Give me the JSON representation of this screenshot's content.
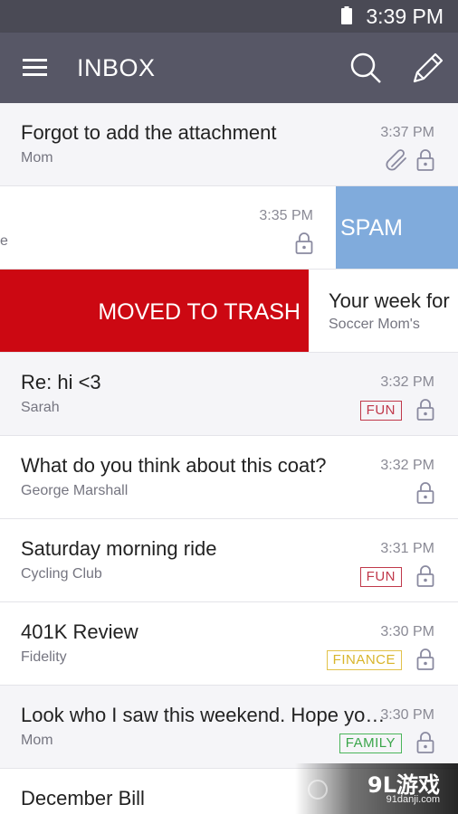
{
  "status_bar": {
    "time": "3:39 PM",
    "battery_icon": "battery-icon"
  },
  "app_bar": {
    "title": "INBOX",
    "menu_icon": "hamburger-menu-icon",
    "search_icon": "search-icon",
    "compose_icon": "pencil-compose-icon"
  },
  "emails": [
    {
      "subject": "Forgot to add the attachment",
      "sender": "Mom",
      "time": "3:37 PM",
      "attachment": true,
      "tag": ""
    },
    {
      "subject": "",
      "sender_fragment": "e",
      "time": "3:35 PM",
      "swipe_action": "SPAM"
    },
    {
      "subject": "Your week for",
      "sender": "Soccer Mom's",
      "swipe_action": "MOVED TO TRASH"
    },
    {
      "subject": "Re: hi <3",
      "sender": "Sarah",
      "time": "3:32 PM",
      "tag": "FUN"
    },
    {
      "subject": "What do you think about this coat?",
      "sender": "George Marshall",
      "time": "3:32 PM",
      "tag": ""
    },
    {
      "subject": "Saturday morning ride",
      "sender": "Cycling Club",
      "time": "3:31 PM",
      "tag": "FUN"
    },
    {
      "subject": "401K Review",
      "sender": "Fidelity",
      "time": "3:30 PM",
      "tag": "FINANCE"
    },
    {
      "subject": "Look who I saw this weekend. Hope yo…",
      "sender": "Mom",
      "time": "3:30 PM",
      "tag": "FAMILY"
    },
    {
      "subject": "December Bill",
      "sender": "",
      "time": "",
      "tag": ""
    }
  ],
  "watermark": {
    "logo": "9L游戏",
    "site": "91danji.com"
  },
  "colors": {
    "status_bar": "#4a4a55",
    "app_bar": "#575766",
    "spam": "#80abdc",
    "trash": "#cc0812",
    "tag_fun": "#c0384a",
    "tag_finance": "#d8b52a",
    "tag_family": "#3aa54a"
  }
}
